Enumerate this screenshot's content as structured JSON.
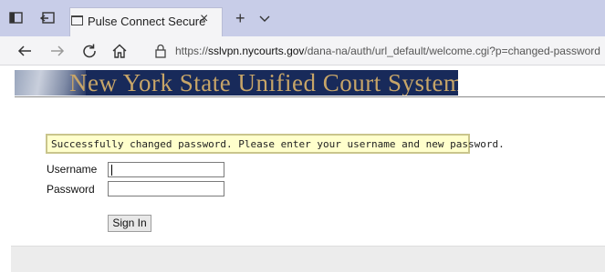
{
  "browser": {
    "tab": {
      "title": "Pulse Connect Secure",
      "close_glyph": "×"
    },
    "new_tab_glyph": "+",
    "icons": {
      "tab_actions": "tab-actions-icon",
      "set_aside": "set-aside-tabs-icon",
      "page": "page-icon",
      "dropdown": "chevron-down-icon",
      "back": "back-arrow-icon",
      "forward": "forward-arrow-icon",
      "refresh": "refresh-icon",
      "home": "home-icon",
      "lock": "lock-icon"
    },
    "address": {
      "scheme": "https://",
      "host": "sslvpn.nycourts.gov",
      "path": "/dana-na/auth/url_default/welcome.cgi?p=changed-password"
    }
  },
  "page": {
    "banner_title": "New York State Unified Court System",
    "message": "Successfully changed password. Please enter your username and new password.",
    "form": {
      "username_label": "Username",
      "username_value": "",
      "password_label": "Password",
      "password_value": "",
      "signin_label": "Sign In"
    }
  },
  "colors": {
    "tabstrip_bg": "#c8cde8",
    "banner_bg": "#182a5a",
    "banner_text": "#c7a568",
    "message_bg": "#ffffcc",
    "message_border": "#c9c58c"
  }
}
